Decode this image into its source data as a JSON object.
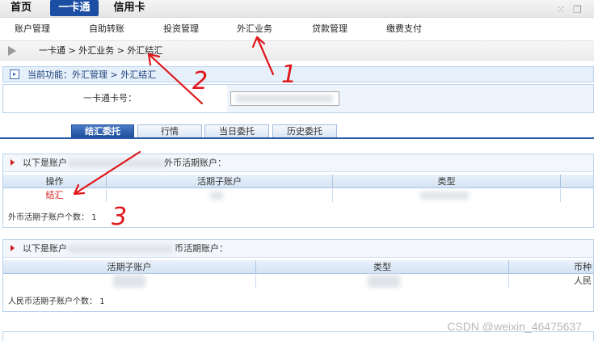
{
  "topnav": {
    "tabs": [
      "首页",
      "一卡通",
      "信用卡"
    ]
  },
  "subnav": {
    "items": [
      "账户管理",
      "自助转账",
      "投资管理",
      "外汇业务",
      "贷款管理",
      "缴费支付"
    ]
  },
  "breadcrumb": {
    "text": "一卡通 > 外汇业务 > 外汇结汇"
  },
  "current_function": {
    "label": "当前功能：外汇管理 > 外汇结汇"
  },
  "card": {
    "label": "一卡通卡号："
  },
  "tabs": [
    "结汇委托",
    "行情",
    "当日委托",
    "历史委托"
  ],
  "foreign_section": {
    "title_prefix": "以下是账户",
    "title_suffix": "外币活期账户：",
    "columns": [
      "操作",
      "活期子账户",
      "类型"
    ],
    "action": "结汇",
    "count_label": "外币活期子账户个数：",
    "count": "1"
  },
  "rmb_section": {
    "title_prefix": "以下是账户",
    "title_suffix": "币活期账户：",
    "columns": [
      "活期子账户",
      "类型",
      "币种"
    ],
    "row_currency": "人民",
    "count_label": "人民币活期子账户个数：",
    "count": "1"
  },
  "annotations": [
    "1",
    "2",
    "3"
  ],
  "watermark": "CSDN @weixin_46475637"
}
